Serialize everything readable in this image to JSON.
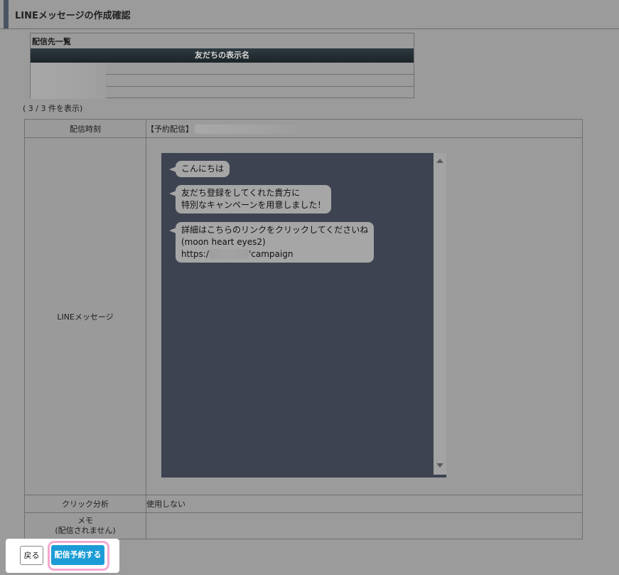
{
  "header": {
    "title": "LINEメッセージの作成確認"
  },
  "recipients": {
    "title": "配信先一覧",
    "column_header": "友だちの表示名",
    "count_text": "( 3 / 3 件を表示)"
  },
  "details": {
    "schedule_label": "配信時刻",
    "schedule_value": "【予約配信】",
    "message_label": "LINEメッセージ",
    "click_label": "クリック分析",
    "click_value": "使用しない",
    "memo_label_line1": "メモ",
    "memo_label_line2": "(配信されません)",
    "memo_value": ""
  },
  "messages": [
    {
      "lines": [
        "こんにちは"
      ]
    },
    {
      "lines": [
        "友だち登録をしてくれた貴方に",
        "特別なキャンペーンを用意しました！"
      ]
    },
    {
      "lines": [
        "詳細はこちらのリンクをクリックしてくださいね",
        "(moon heart eyes2)"
      ],
      "url_prefix": "https:/",
      "url_suffix": "'campaign"
    }
  ],
  "actions": {
    "back_label": "戻る",
    "reserve_label": "配信予約する"
  },
  "colors": {
    "preview_bg": "#3d4350",
    "primary_button": "#1c9cd6",
    "highlight_outline": "#f3a8d0"
  }
}
